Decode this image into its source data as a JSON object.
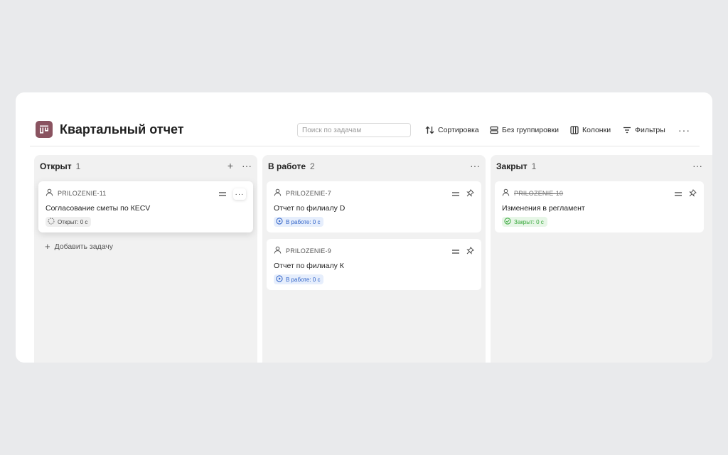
{
  "board": {
    "title": "Квартальный отчет",
    "icon": "board-icon",
    "accent": "#8a5360"
  },
  "toolbar": {
    "search_placeholder": "Поиск по задачам",
    "sort_label": "Сортировка",
    "group_label": "Без группировки",
    "columns_label": "Колонки",
    "filters_label": "Фильтры",
    "more": "···"
  },
  "columns": [
    {
      "title": "Открыт",
      "count": "1",
      "add": "+",
      "more": "···",
      "add_task_label": "Добавить задачу",
      "cards": [
        {
          "key": "PRILOZENIE-11",
          "title": "Согласование сметы по КЕСV",
          "status": "Открыт: 0 с",
          "status_type": "open"
        }
      ]
    },
    {
      "title": "В работе",
      "count": "2",
      "more": "···",
      "cards": [
        {
          "key": "PRILOZENIE-7",
          "title": "Отчет по филиалу D",
          "status": "В работе: 0 с",
          "status_type": "work"
        },
        {
          "key": "PRILOZENIE-9",
          "title": "Отчет по филиалу К",
          "status": "В работе: 0 с",
          "status_type": "work"
        }
      ]
    },
    {
      "title": "Закрыт",
      "count": "1",
      "more": "···",
      "cards": [
        {
          "key": "PRILOZENIE-10",
          "title": "Изменения в регламент",
          "status": "Закрыт: 0 с",
          "status_type": "done"
        }
      ]
    }
  ],
  "colors": {
    "background": "#e9eaec",
    "column_bg": "#f1f1f1",
    "status_open": "#444444",
    "status_work": "#2f62c7",
    "status_done": "#38a83b"
  }
}
